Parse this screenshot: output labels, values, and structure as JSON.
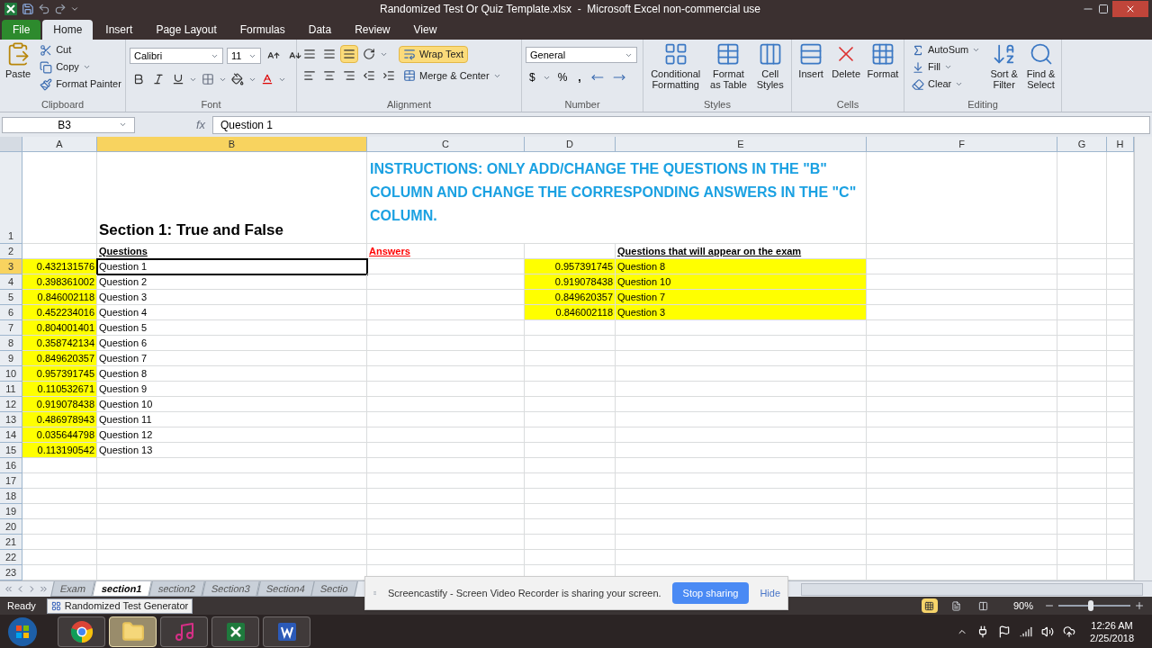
{
  "window": {
    "title": "Randomized Test Or Quiz Template.xlsx  -  Microsoft Excel non-commercial use"
  },
  "ribbon": {
    "tabs": [
      {
        "label": "File",
        "kind": "file",
        "selected": false
      },
      {
        "label": "Home",
        "kind": "tab",
        "selected": true
      },
      {
        "label": "Insert",
        "kind": "tab",
        "selected": false
      },
      {
        "label": "Page Layout",
        "kind": "tab",
        "selected": false
      },
      {
        "label": "Formulas",
        "kind": "tab",
        "selected": false
      },
      {
        "label": "Data",
        "kind": "tab",
        "selected": false
      },
      {
        "label": "Review",
        "kind": "tab",
        "selected": false
      },
      {
        "label": "View",
        "kind": "tab",
        "selected": false
      }
    ],
    "clipboard": {
      "label": "Clipboard",
      "paste": "Paste",
      "cut": "Cut",
      "copy": "Copy",
      "painter": "Format Painter"
    },
    "font": {
      "label": "Font",
      "family": "Calibri",
      "size": "11"
    },
    "alignment": {
      "label": "Alignment",
      "bottom_align_on": true,
      "wrap_text": "Wrap Text",
      "wrap_text_on": true,
      "merge": "Merge & Center"
    },
    "number": {
      "label": "Number",
      "format": "General",
      "currency": "$",
      "percent": "%",
      "comma": ","
    },
    "styles": {
      "label": "Styles",
      "commands": [
        "Conditional Formatting",
        "Format as Table",
        "Cell Styles"
      ]
    },
    "cells": {
      "label": "Cells",
      "commands": [
        "Insert",
        "Delete",
        "Format"
      ]
    },
    "editing": {
      "label": "Editing",
      "small": [
        "AutoSum",
        "Fill",
        "Clear"
      ],
      "large": [
        "Sort & Filter",
        "Find & Select"
      ]
    }
  },
  "formula_bar": {
    "name_box": "B3",
    "function_label": "fx",
    "formula": "Question 1"
  },
  "sheet": {
    "columns": [
      {
        "label": "A",
        "selected": false
      },
      {
        "label": "B",
        "selected": true
      },
      {
        "label": "C",
        "selected": false
      },
      {
        "label": "D",
        "selected": false
      },
      {
        "label": "E",
        "selected": false
      },
      {
        "label": "F",
        "selected": false
      },
      {
        "label": "G",
        "selected": false
      },
      {
        "label": "H",
        "selected": false
      }
    ],
    "rows": [
      {
        "number": "1",
        "selected": false,
        "b": {
          "text": "Section 1: True and False",
          "kind": "title",
          "highlighted": false,
          "selected": false
        },
        "c": {
          "text": "INSTRUCTIONS: ONLY ADD/CHANGE THE QUESTIONS IN THE \"B\" COLUMN AND CHANGE THE CORRESPONDING ANSWERS IN THE \"C\" COLUMN.",
          "kind": "note",
          "merged": true,
          "highlighted": false,
          "selected": false
        }
      },
      {
        "number": "2",
        "selected": false,
        "b": {
          "text": "Questions",
          "kind": "heading",
          "highlighted": false,
          "selected": false
        },
        "c": {
          "text": "Answers",
          "kind": "alert-heading",
          "highlighted": false,
          "selected": false
        },
        "e": {
          "text": "Questions that will appear on the exam",
          "kind": "heading",
          "highlighted": false,
          "selected": false
        }
      },
      {
        "number": "3",
        "selected": true,
        "a": {
          "text": "0.432131576",
          "kind": "number",
          "highlighted": true,
          "selected": false
        },
        "b": {
          "text": "Question 1",
          "kind": "text",
          "highlighted": false,
          "selected": true
        },
        "d": {
          "text": "0.957391745",
          "kind": "number",
          "highlighted": true,
          "selected": false
        },
        "e": {
          "text": "Question 8",
          "kind": "text",
          "highlighted": true,
          "selected": false
        }
      },
      {
        "number": "4",
        "selected": false,
        "a": {
          "text": "0.398361002",
          "kind": "number",
          "highlighted": true,
          "selected": false
        },
        "b": {
          "text": "Question 2",
          "kind": "text",
          "highlighted": false,
          "selected": false
        },
        "d": {
          "text": "0.919078438",
          "kind": "number",
          "highlighted": true,
          "selected": false
        },
        "e": {
          "text": "Question 10",
          "kind": "text",
          "highlighted": true,
          "selected": false
        }
      },
      {
        "number": "5",
        "selected": false,
        "a": {
          "text": "0.846002118",
          "kind": "number",
          "highlighted": true,
          "selected": false
        },
        "b": {
          "text": "Question 3",
          "kind": "text",
          "highlighted": false,
          "selected": false
        },
        "d": {
          "text": "0.849620357",
          "kind": "number",
          "highlighted": true,
          "selected": false
        },
        "e": {
          "text": "Question 7",
          "kind": "text",
          "highlighted": true,
          "selected": false
        }
      },
      {
        "number": "6",
        "selected": false,
        "a": {
          "text": "0.452234016",
          "kind": "number",
          "highlighted": true,
          "selected": false
        },
        "b": {
          "text": "Question 4",
          "kind": "text",
          "highlighted": false,
          "selected": false
        },
        "d": {
          "text": "0.846002118",
          "kind": "number",
          "highlighted": true,
          "selected": false
        },
        "e": {
          "text": "Question 3",
          "kind": "text",
          "highlighted": true,
          "selected": false
        }
      },
      {
        "number": "7",
        "selected": false,
        "a": {
          "text": "0.804001401",
          "kind": "number",
          "highlighted": true,
          "selected": false
        },
        "b": {
          "text": "Question 5",
          "kind": "text",
          "highlighted": false,
          "selected": false
        }
      },
      {
        "number": "8",
        "selected": false,
        "a": {
          "text": "0.358742134",
          "kind": "number",
          "highlighted": true,
          "selected": false
        },
        "b": {
          "text": "Question 6",
          "kind": "text",
          "highlighted": false,
          "selected": false
        }
      },
      {
        "number": "9",
        "selected": false,
        "a": {
          "text": "0.849620357",
          "kind": "number",
          "highlighted": true,
          "selected": false
        },
        "b": {
          "text": "Question 7",
          "kind": "text",
          "highlighted": false,
          "selected": false
        }
      },
      {
        "number": "10",
        "selected": false,
        "a": {
          "text": "0.957391745",
          "kind": "number",
          "highlighted": true,
          "selected": false
        },
        "b": {
          "text": "Question 8",
          "kind": "text",
          "highlighted": false,
          "selected": false
        }
      },
      {
        "number": "11",
        "selected": false,
        "a": {
          "text": "0.110532671",
          "kind": "number",
          "highlighted": true,
          "selected": false
        },
        "b": {
          "text": "Question 9",
          "kind": "text",
          "highlighted": false,
          "selected": false
        }
      },
      {
        "number": "12",
        "selected": false,
        "a": {
          "text": "0.919078438",
          "kind": "number",
          "highlighted": true,
          "selected": false
        },
        "b": {
          "text": "Question 10",
          "kind": "text",
          "highlighted": false,
          "selected": false
        }
      },
      {
        "number": "13",
        "selected": false,
        "a": {
          "text": "0.486978943",
          "kind": "number",
          "highlighted": true,
          "selected": false
        },
        "b": {
          "text": "Question 11",
          "kind": "text",
          "highlighted": false,
          "selected": false
        }
      },
      {
        "number": "14",
        "selected": false,
        "a": {
          "text": "0.035644798",
          "kind": "number",
          "highlighted": true,
          "selected": false
        },
        "b": {
          "text": "Question 12",
          "kind": "text",
          "highlighted": false,
          "selected": false
        }
      },
      {
        "number": "15",
        "selected": false,
        "a": {
          "text": "0.113190542",
          "kind": "number",
          "highlighted": true,
          "selected": false
        },
        "b": {
          "text": "Question 13",
          "kind": "text",
          "highlighted": false,
          "selected": false
        }
      },
      {
        "number": "16",
        "selected": false
      },
      {
        "number": "17",
        "selected": false
      },
      {
        "number": "18",
        "selected": false
      },
      {
        "number": "19",
        "selected": false
      },
      {
        "number": "20",
        "selected": false
      },
      {
        "number": "21",
        "selected": false
      },
      {
        "number": "22",
        "selected": false
      },
      {
        "number": "23",
        "selected": false
      }
    ]
  },
  "sheet_tabs": [
    {
      "label": "Exam",
      "selected": false
    },
    {
      "label": "section1",
      "selected": true
    },
    {
      "label": "section2",
      "selected": false
    },
    {
      "label": "Section3",
      "selected": false
    },
    {
      "label": "Section4",
      "selected": false
    },
    {
      "label": "Sectio",
      "selected": false
    }
  ],
  "status_bar": {
    "mode": "Ready",
    "tooltip": "Randomized Test Generator",
    "views": [
      {
        "kind": "normal",
        "selected": true
      },
      {
        "kind": "page-layout",
        "selected": false
      },
      {
        "kind": "page-break",
        "selected": false
      }
    ],
    "zoom": "90%",
    "zoom_slider": {
      "level": 0.45
    }
  },
  "notification": {
    "message": "Screencastify - Screen Video Recorder is sharing your screen.",
    "button": "Stop sharing",
    "link": "Hide"
  },
  "taskbar": {
    "apps": [
      {
        "kind": "chrome",
        "selected": false
      },
      {
        "kind": "explorer",
        "selected": true
      },
      {
        "kind": "itunes",
        "selected": false
      },
      {
        "kind": "excel",
        "selected": false
      },
      {
        "kind": "word",
        "selected": false
      }
    ],
    "time": "12:26 AM",
    "date": "2/25/2018"
  }
}
